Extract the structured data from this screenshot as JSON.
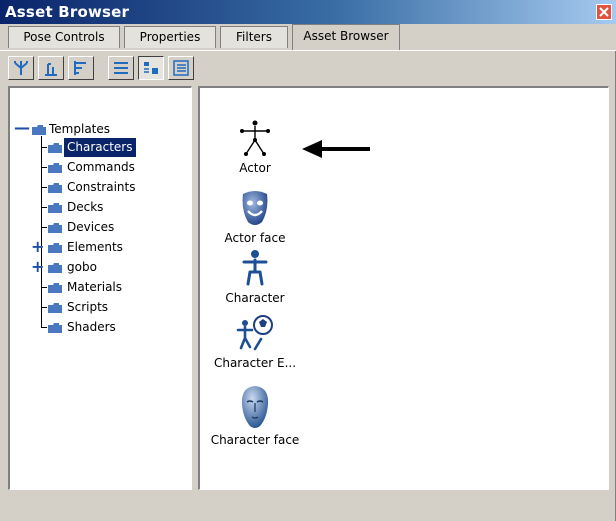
{
  "window": {
    "title": "Asset Browser"
  },
  "tabs": [
    {
      "label": "Pose Controls",
      "active": false
    },
    {
      "label": "Properties",
      "active": false
    },
    {
      "label": "Filters",
      "active": false
    },
    {
      "label": "Asset Browser",
      "active": true
    }
  ],
  "toolbar": {
    "buttons": [
      {
        "icon": "tree-view-icon"
      },
      {
        "icon": "bar-view-icon"
      },
      {
        "icon": "branch-view-icon"
      },
      {
        "icon": "list-view-icon"
      },
      {
        "icon": "icon-view-icon",
        "pressed": true
      },
      {
        "icon": "detail-view-icon"
      }
    ]
  },
  "tree": {
    "root": {
      "label": "Templates",
      "expanded": true
    },
    "children": [
      {
        "label": "Characters",
        "selected": true,
        "expandable": false
      },
      {
        "label": "Commands",
        "expandable": false
      },
      {
        "label": "Constraints",
        "expandable": false
      },
      {
        "label": "Decks",
        "expandable": false
      },
      {
        "label": "Devices",
        "expandable": false
      },
      {
        "label": "Elements",
        "expandable": true
      },
      {
        "label": "gobo",
        "expandable": true
      },
      {
        "label": "Materials",
        "expandable": false
      },
      {
        "label": "Scripts",
        "expandable": false
      },
      {
        "label": "Shaders",
        "expandable": false
      }
    ]
  },
  "assets": [
    {
      "label": "Actor",
      "icon": "stick-figure-icon"
    },
    {
      "label": "Actor face",
      "icon": "face-mask-icon"
    },
    {
      "label": "Character",
      "icon": "character-figure-icon"
    },
    {
      "label": "Character E...",
      "icon": "character-soccer-icon"
    },
    {
      "label": "Character face",
      "icon": "head-icon"
    }
  ],
  "annotation": {
    "icon": "left-arrow-icon"
  },
  "colors": {
    "title_gradient_start": "#0a246a",
    "title_gradient_end": "#a6caf0",
    "selection": "#0a246a",
    "folder": "#4a78c0",
    "close_button": "#e0533c"
  }
}
